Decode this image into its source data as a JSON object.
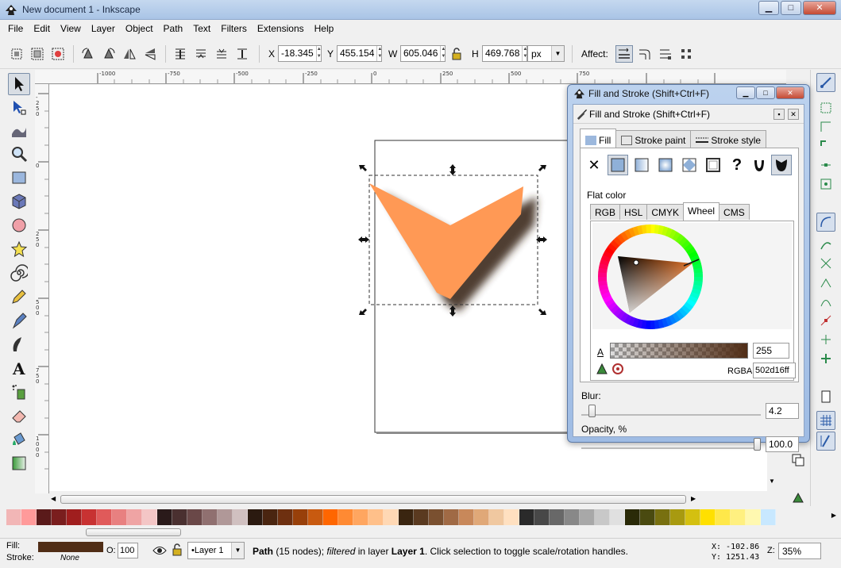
{
  "window": {
    "title": "New document 1 - Inkscape"
  },
  "menu": [
    "File",
    "Edit",
    "View",
    "Layer",
    "Object",
    "Path",
    "Text",
    "Filters",
    "Extensions",
    "Help"
  ],
  "toolctl": {
    "x_label": "X",
    "x": "-18.345",
    "y_label": "Y",
    "y": "455.154",
    "w_label": "W",
    "w": "605.046",
    "h_label": "H",
    "h": "469.768",
    "unit": "px",
    "affect_label": "Affect:"
  },
  "ruler_h": [
    "-1000",
    "-750",
    "-500",
    "-250",
    "0",
    "250",
    "500",
    "750"
  ],
  "ruler_v": [
    "-250",
    "0",
    "250",
    "500",
    "750",
    "1000",
    "1250"
  ],
  "dialog": {
    "window_title": "Fill and Stroke (Shift+Ctrl+F)",
    "panel_title": "Fill and Stroke (Shift+Ctrl+F)",
    "tabs": [
      "Fill",
      "Stroke paint",
      "Stroke style"
    ],
    "flat_label": "Flat color",
    "color_tabs": [
      "RGB",
      "HSL",
      "CMYK",
      "Wheel",
      "CMS"
    ],
    "alpha_label": "A",
    "alpha": "255",
    "rgba_label": "RGBA:",
    "rgba": "502d16ff",
    "blur_label": "Blur:",
    "blur": "4.2",
    "blur_fraction": 0.042,
    "opacity_label": "Opacity, %",
    "opacity": "100.0",
    "opacity_fraction": 1.0
  },
  "palette": [
    "#f2b6b6",
    "#ff9a9a",
    "#5a1a1a",
    "#7a1e1e",
    "#a01e1e",
    "#c83232",
    "#e05a5a",
    "#e88080",
    "#efa4a4",
    "#f4c6c6",
    "#2a1a1a",
    "#4a3030",
    "#6a4848",
    "#907070",
    "#b09898",
    "#d0c0c0",
    "#2b1a10",
    "#4a2510",
    "#6e3010",
    "#98400a",
    "#c85a10",
    "#ff6600",
    "#ff8a33",
    "#ffa660",
    "#ffc08a",
    "#ffd8b4",
    "#3a2510",
    "#5a3a20",
    "#7a5030",
    "#a06a45",
    "#c8885a",
    "#e0a878",
    "#f0c8a0",
    "#ffe0c0",
    "#2a2a2a",
    "#484848",
    "#686868",
    "#888888",
    "#a8a8a8",
    "#c8c8c8",
    "#e0e0e0",
    "#2a2a08",
    "#4a4a10",
    "#787010",
    "#a89a10",
    "#d4c010",
    "#ffe000",
    "#ffe84a",
    "#fff080",
    "#fff8b0",
    "#c8e8ff"
  ],
  "status": {
    "fill_label": "Fill:",
    "fill_color": "#502d16",
    "stroke_label": "Stroke:",
    "stroke_value": "None",
    "opacity_label": "O:",
    "opacity": "100",
    "layer": "•Layer 1",
    "msg_bold": "Path",
    "msg_a": " (15 nodes); ",
    "msg_italic": "filtered",
    "msg_b": " in layer ",
    "msg_layer": "Layer 1",
    "msg_c": ". Click selection to toggle scale/rotation handles.",
    "x_coord": "X: -102.86",
    "y_coord": "Y: 1251.43",
    "zoom_label": "Z:",
    "zoom": "35%"
  },
  "colors": {
    "shape_fill": "#ff9955",
    "shadow": "#3c2a1a",
    "accent": "#3b6bb5"
  }
}
